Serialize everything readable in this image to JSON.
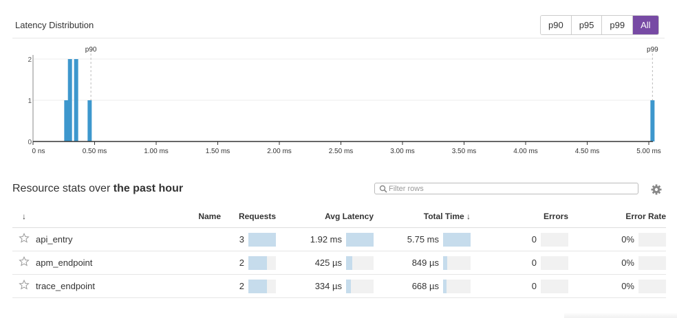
{
  "latency": {
    "title": "Latency Distribution",
    "percentile_buttons": [
      {
        "label": "p90",
        "active": false
      },
      {
        "label": "p95",
        "active": false
      },
      {
        "label": "p99",
        "active": false
      },
      {
        "label": "All",
        "active": true
      }
    ]
  },
  "chart_data": {
    "type": "bar",
    "title": "Latency Distribution",
    "xlabel": "",
    "ylabel": "",
    "x_ticks": [
      "0 ns",
      "0.50 ms",
      "1.00 ms",
      "1.50 ms",
      "2.00 ms",
      "2.50 ms",
      "3.00 ms",
      "3.50 ms",
      "4.00 ms",
      "4.50 ms",
      "5.00 ms"
    ],
    "x_tick_values_ms": [
      0,
      0.5,
      1.0,
      1.5,
      2.0,
      2.5,
      3.0,
      3.5,
      4.0,
      4.5,
      5.0
    ],
    "y_ticks": [
      0,
      1,
      2
    ],
    "xlim_ms": [
      0,
      5.05
    ],
    "ylim": [
      0,
      2.1
    ],
    "bars": [
      {
        "x_ms": 0.27,
        "count": 1
      },
      {
        "x_ms": 0.3,
        "count": 2
      },
      {
        "x_ms": 0.35,
        "count": 2
      },
      {
        "x_ms": 0.46,
        "count": 1
      },
      {
        "x_ms": 5.03,
        "count": 1
      }
    ],
    "markers": [
      {
        "label": "p90",
        "x_ms": 0.47
      },
      {
        "label": "p99",
        "x_ms": 5.03
      }
    ],
    "bar_color": "#3d97cd",
    "grid": true
  },
  "resources": {
    "title_prefix": "Resource stats over",
    "title_bold": "the past hour",
    "filter_placeholder": "Filter rows",
    "columns": {
      "sort": "↓",
      "name": "Name",
      "requests": "Requests",
      "avg_latency": "Avg Latency",
      "total_time": "Total Time ↓",
      "errors": "Errors",
      "error_rate": "Error Rate"
    },
    "rows": [
      {
        "name": "api_entry",
        "requests": "3",
        "requests_frac": 1.0,
        "avg_latency": "1.92 ms",
        "avg_latency_frac": 1.0,
        "total_time": "5.75 ms",
        "total_time_frac": 1.0,
        "errors": "0",
        "errors_frac": 0,
        "error_rate": "0%",
        "error_rate_frac": 0
      },
      {
        "name": "apm_endpoint",
        "requests": "2",
        "requests_frac": 0.67,
        "avg_latency": "425 µs",
        "avg_latency_frac": 0.22,
        "total_time": "849 µs",
        "total_time_frac": 0.15,
        "errors": "0",
        "errors_frac": 0,
        "error_rate": "0%",
        "error_rate_frac": 0
      },
      {
        "name": "trace_endpoint",
        "requests": "2",
        "requests_frac": 0.67,
        "avg_latency": "334 µs",
        "avg_latency_frac": 0.17,
        "total_time": "668 µs",
        "total_time_frac": 0.12,
        "errors": "0",
        "errors_frac": 0,
        "error_rate": "0%",
        "error_rate_frac": 0
      }
    ]
  },
  "colors": {
    "accent": "#774aa4",
    "bar_fill": "#c6dcec",
    "bar_track": "#f1f1f1",
    "hist_bar": "#3d97cd"
  }
}
